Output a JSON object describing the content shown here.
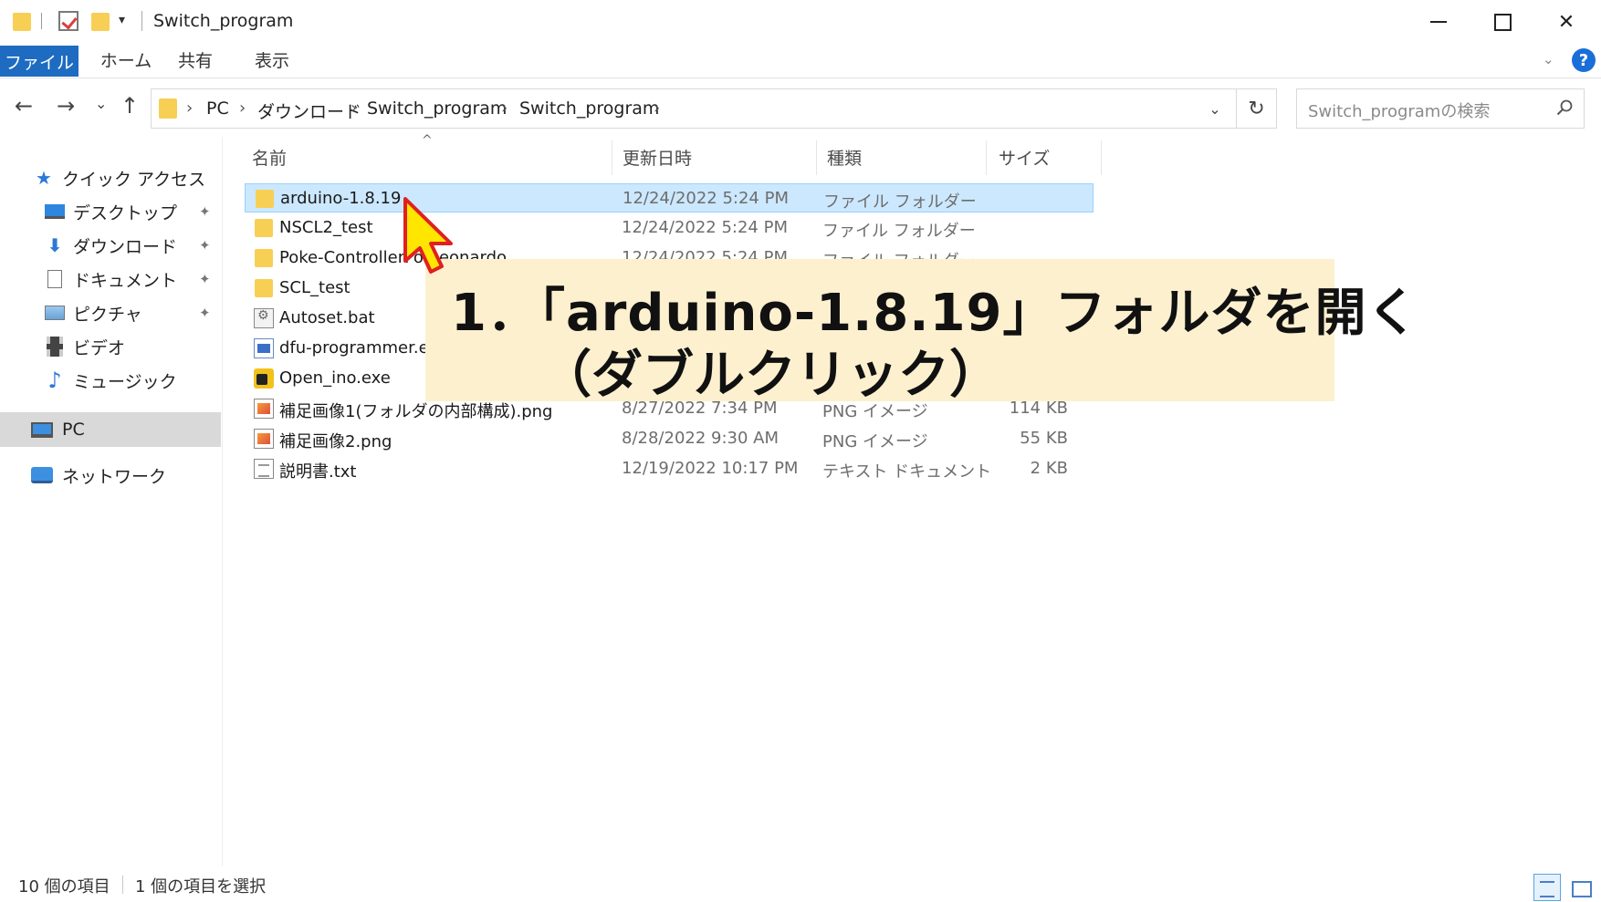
{
  "window": {
    "title": "Switch_program",
    "qa_dropdown": "▾",
    "minimize": "",
    "maximize": "",
    "close": "✕"
  },
  "ribbon": {
    "tabs": [
      "ファイル",
      "ホーム",
      "共有",
      "表示"
    ],
    "expand": "⌄",
    "help": "?"
  },
  "nav": {
    "back": "←",
    "forward": "→",
    "recent": "⌄",
    "up": "↑",
    "breadcrumb": [
      "PC",
      "ダウンロード",
      "Switch_program",
      "Switch_program"
    ],
    "crumb_sep": "›",
    "address_dropdown": "⌄",
    "refresh": "↻",
    "search_placeholder": "Switch_programの検索"
  },
  "sidebar": {
    "items": [
      {
        "label": "クイック アクセス",
        "icon": "star-icon"
      },
      {
        "label": "デスクトップ",
        "icon": "desktop-icon",
        "pinned": true
      },
      {
        "label": "ダウンロード",
        "icon": "download-icon",
        "pinned": true
      },
      {
        "label": "ドキュメント",
        "icon": "document-icon",
        "pinned": true
      },
      {
        "label": "ピクチャ",
        "icon": "pictures-icon",
        "pinned": true
      },
      {
        "label": "ビデオ",
        "icon": "video-icon"
      },
      {
        "label": "ミュージック",
        "icon": "music-icon"
      },
      {
        "label": "PC",
        "icon": "pc-icon",
        "selected": true
      },
      {
        "label": "ネットワーク",
        "icon": "network-icon"
      }
    ],
    "pin_glyph": "📌"
  },
  "filelist": {
    "columns": [
      "名前",
      "更新日時",
      "種類",
      "サイズ"
    ],
    "sort_glyph": "^",
    "rows": [
      {
        "name": "arduino-1.8.19",
        "date": "12/24/2022 5:24 PM",
        "type": "ファイル フォルダー",
        "size": "",
        "icon": "folder-icon",
        "selected": true
      },
      {
        "name": "NSCL2_test",
        "date": "12/24/2022 5:24 PM",
        "type": "ファイル フォルダー",
        "size": "",
        "icon": "folder-icon"
      },
      {
        "name": "Poke-ControllerForLeonardo",
        "date": "12/24/2022 5:24 PM",
        "type": "ファイル フォルダー",
        "size": "",
        "icon": "folder-icon"
      },
      {
        "name": "SCL_test",
        "date": "",
        "type": "",
        "size": "",
        "icon": "folder-icon"
      },
      {
        "name": "Autoset.bat",
        "date": "",
        "type": "",
        "size": "",
        "icon": "bat-file-icon"
      },
      {
        "name": "dfu-programmer.exe",
        "date": "",
        "type": "",
        "size": "",
        "icon": "exe-file-icon"
      },
      {
        "name": "Open_ino.exe",
        "date": "",
        "type": "",
        "size": "",
        "icon": "app-exe-icon"
      },
      {
        "name": "補足画像1(フォルダの内部構成).png",
        "date": "8/27/2022 7:34 PM",
        "type": "PNG イメージ",
        "size": "114 KB",
        "icon": "png-file-icon"
      },
      {
        "name": "補足画像2.png",
        "date": "8/28/2022 9:30 AM",
        "type": "PNG イメージ",
        "size": "55 KB",
        "icon": "png-file-icon"
      },
      {
        "name": "説明書.txt",
        "date": "12/19/2022 10:17 PM",
        "type": "テキスト ドキュメント",
        "size": "2 KB",
        "icon": "text-file-icon"
      }
    ]
  },
  "callout": {
    "line1": "1．「arduino-1.8.19」フォルダを開く",
    "line2": "（ダブルクリック）",
    "background": "#fdf0cf"
  },
  "status": {
    "count": "10 個の項目",
    "selection": "1 個の項目を選択"
  },
  "colors": {
    "file_tab": "#1e6cc1",
    "selection": "#cce8ff",
    "folder": "#f8cf55",
    "cursor": "#ffe600"
  }
}
